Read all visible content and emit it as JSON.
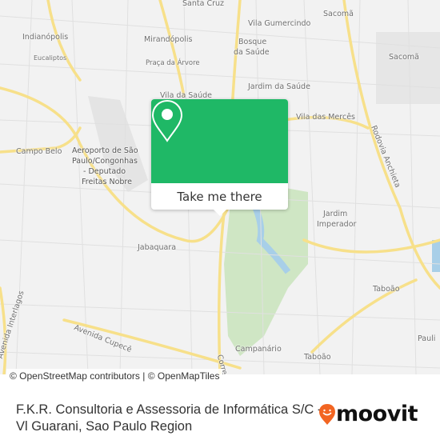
{
  "map": {
    "labels": {
      "santa_cruz": "Santa Cruz",
      "vila_gumercindo": "Vila Gumercindo",
      "sacoma_top": "Sacomã",
      "indianopolis": "Indianópolis",
      "mirandopolis": "Mirandópolis",
      "bosque_1": "Bosque",
      "bosque_2": "da Saúde",
      "eucaliptos": "Eucaliptos",
      "praca_arvore": "Praça da Árvore",
      "sacoma": "Sacomã",
      "jardim_saude": "Jardim da Saúde",
      "vila_saude": "Vila da Saúde",
      "vila_merces": "Vila das Mercês",
      "rodovia_anchieta": "Rodovia Anchieta",
      "campo_belo": "Campo Belo",
      "aeroporto_1": "Aeroporto de São",
      "aeroporto_2": "Paulo/Congonhas",
      "aeroporto_3": "- Deputado",
      "aeroporto_4": "Freitas Nobre",
      "jardim_imperador_1": "Jardim",
      "jardim_imperador_2": "Imperador",
      "jabaquara": "Jabaquara",
      "taboao_right": "Taboão",
      "avenida_cupece": "Avenida Cupecê",
      "avenida_interlagos": "Avenida Interlagos",
      "campanario": "Campanário",
      "taboao": "Taboão",
      "pauli": "Pauli",
      "corre": "Corre"
    },
    "colors": {
      "land": "#f2f2f2",
      "road_major": "#f7e08a",
      "park": "#cfe6c4",
      "water": "#a8cfe8",
      "popup_green": "#1fb866"
    }
  },
  "popup": {
    "icon": "map-pin-icon",
    "button_label": "Take me there"
  },
  "attribution": "© OpenStreetMap contributors | © OpenMapTiles",
  "footer": {
    "title": "F.K.R. Consultoria e Assessoria de Informática S/C - Vl Guarani, Sao Paulo Region",
    "brand": "moovit",
    "brand_color": "#f26522"
  }
}
